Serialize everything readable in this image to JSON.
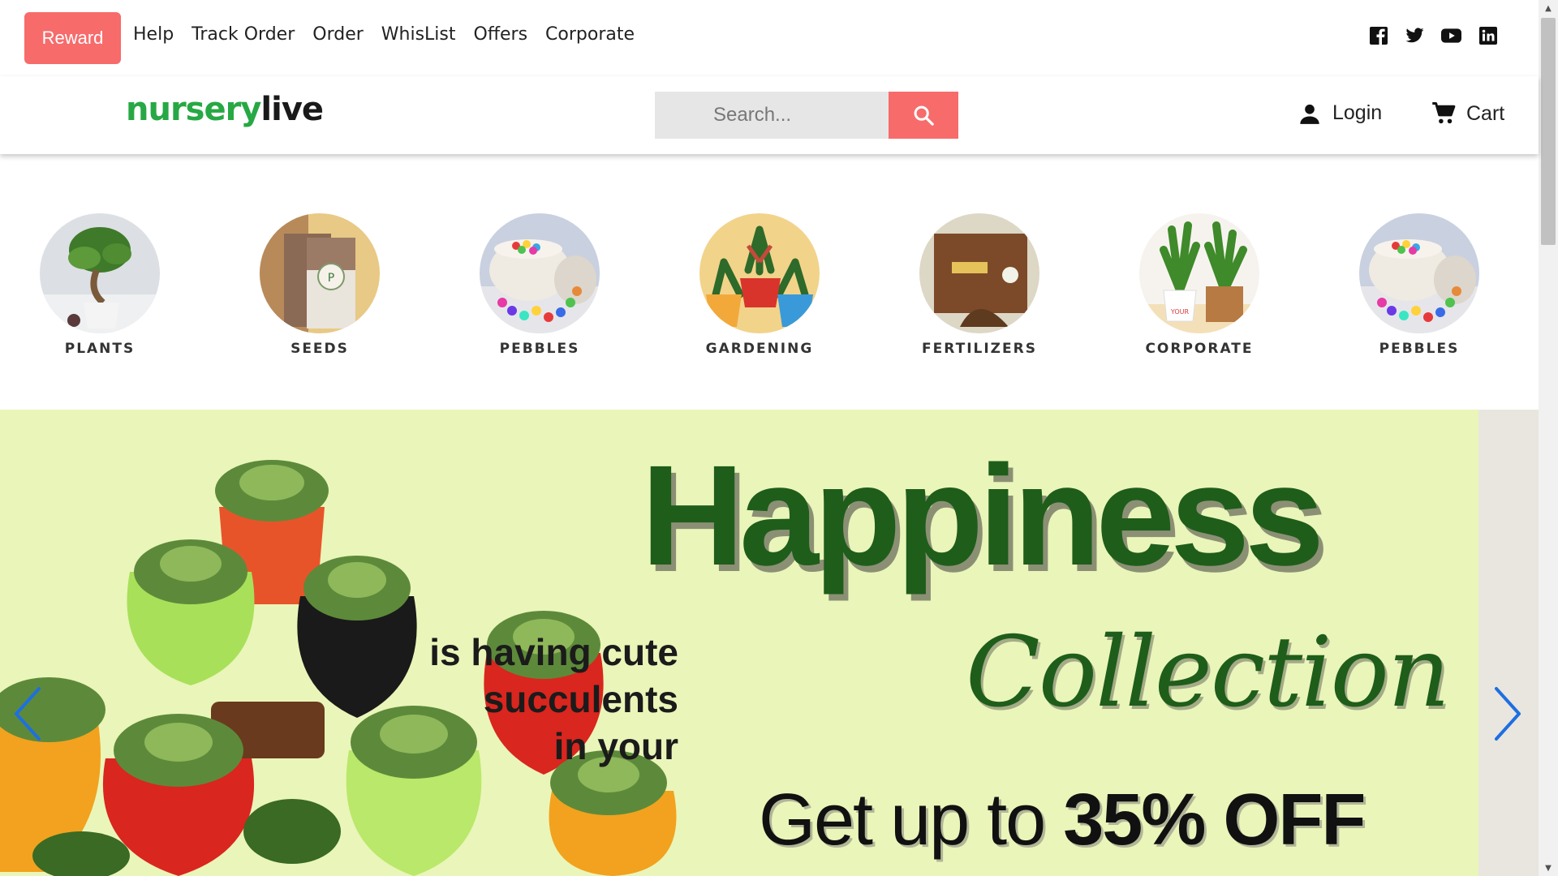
{
  "topbar": {
    "reward_label": "Reward",
    "nav": [
      "Help",
      "Track Order",
      "Order",
      "WhisList",
      "Offers",
      "Corporate"
    ],
    "social_icons": [
      "facebook-icon",
      "twitter-icon",
      "youtube-icon",
      "linkedin-icon"
    ]
  },
  "header": {
    "logo_part1": "nursery",
    "logo_part2": "live",
    "search_placeholder": "Search...",
    "login_label": "Login",
    "cart_label": "Cart"
  },
  "categories": [
    {
      "label": "PLANTS"
    },
    {
      "label": "SEEDS"
    },
    {
      "label": "PEBBLES"
    },
    {
      "label": "GARDENING"
    },
    {
      "label": "FERTILIZERS"
    },
    {
      "label": "CORPORATE"
    },
    {
      "label": "PEBBLES"
    }
  ],
  "banner": {
    "title": "Happiness",
    "line1": "is having cute",
    "line2": "succulents",
    "line3": "in your",
    "script_word": "Collection",
    "offer_prefix": "Get up to ",
    "offer_value": "35% OFF"
  },
  "colors": {
    "accent": "#f76b6b",
    "brand_green": "#27a844",
    "banner_bg": "#eaf5b9",
    "banner_title": "#1f5d1b",
    "arrow_blue": "#1e6fe0"
  }
}
